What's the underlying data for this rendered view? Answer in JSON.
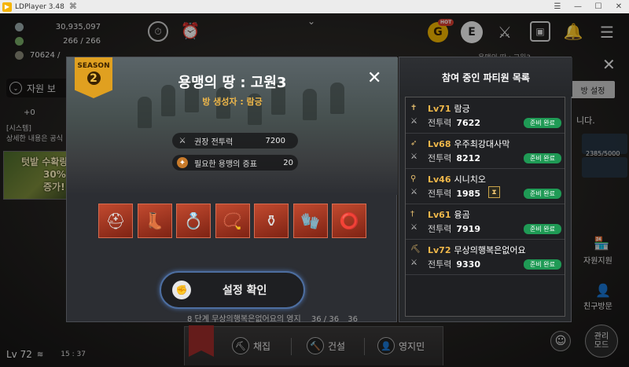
{
  "window": {
    "title": "LDPlayer 3.48"
  },
  "hud": {
    "silver": "30,935,097",
    "capacity": "266 / 266",
    "power_partial": "70624 /",
    "resource_btn": "자원 보",
    "notif_plus": "+0",
    "system_tag": "[시스템]",
    "system_msg": "상세한 내용은 공식",
    "promo_title": "텃밭 수확량",
    "promo_pct": "30% 증가!",
    "level": "Lv 72",
    "time": "15 : 37",
    "hot_badge": "HOT"
  },
  "underlay": {
    "territory_label": "용맹의 땅 : 고원3",
    "settings_btn": "방 설정",
    "chat_hint": "니다.",
    "progress": "2385/5000",
    "side_support": "자원지원",
    "side_visit": "친구방문",
    "manage": "관리\n모드",
    "footer_text": "8 단계  무상의행복은없어요의 영지",
    "footer_count": "36 / 36",
    "footer_count2": "36"
  },
  "bottombar": {
    "gather": "채집",
    "build": "건설",
    "resident": "영지민"
  },
  "modal": {
    "season_label": "SEASON",
    "season_num": "2",
    "title": "용맹의 땅 : 고원3",
    "creator": "방 생성자 : 람긍",
    "rec_power_label": "권장 전투력",
    "rec_power_value": "7200",
    "proof_label": "필요한 용맹의 증표",
    "proof_value": "20",
    "confirm_label": "설정 확인",
    "items": [
      "helmet",
      "boots",
      "ring",
      "necklace",
      "bracelet",
      "gauntlet",
      "cuff"
    ]
  },
  "party": {
    "title": "참여 중인 파티원 목록",
    "power_label": "전투력",
    "ready_label": "준비 완료",
    "members": [
      {
        "level": "Lv71",
        "name": "람긍",
        "power": "7622"
      },
      {
        "level": "Lv68",
        "name": "우주최강대사막",
        "power": "8212"
      },
      {
        "level": "Lv46",
        "name": "시니치오",
        "power": "1985"
      },
      {
        "level": "Lv61",
        "name": "융곰",
        "power": "7919"
      },
      {
        "level": "Lv72",
        "name": "무상의행복은없어요",
        "power": "9330"
      }
    ]
  },
  "colors": {
    "accent": "#f0b84a",
    "ready": "#1f9a55",
    "item_bg": "#a83a22"
  }
}
